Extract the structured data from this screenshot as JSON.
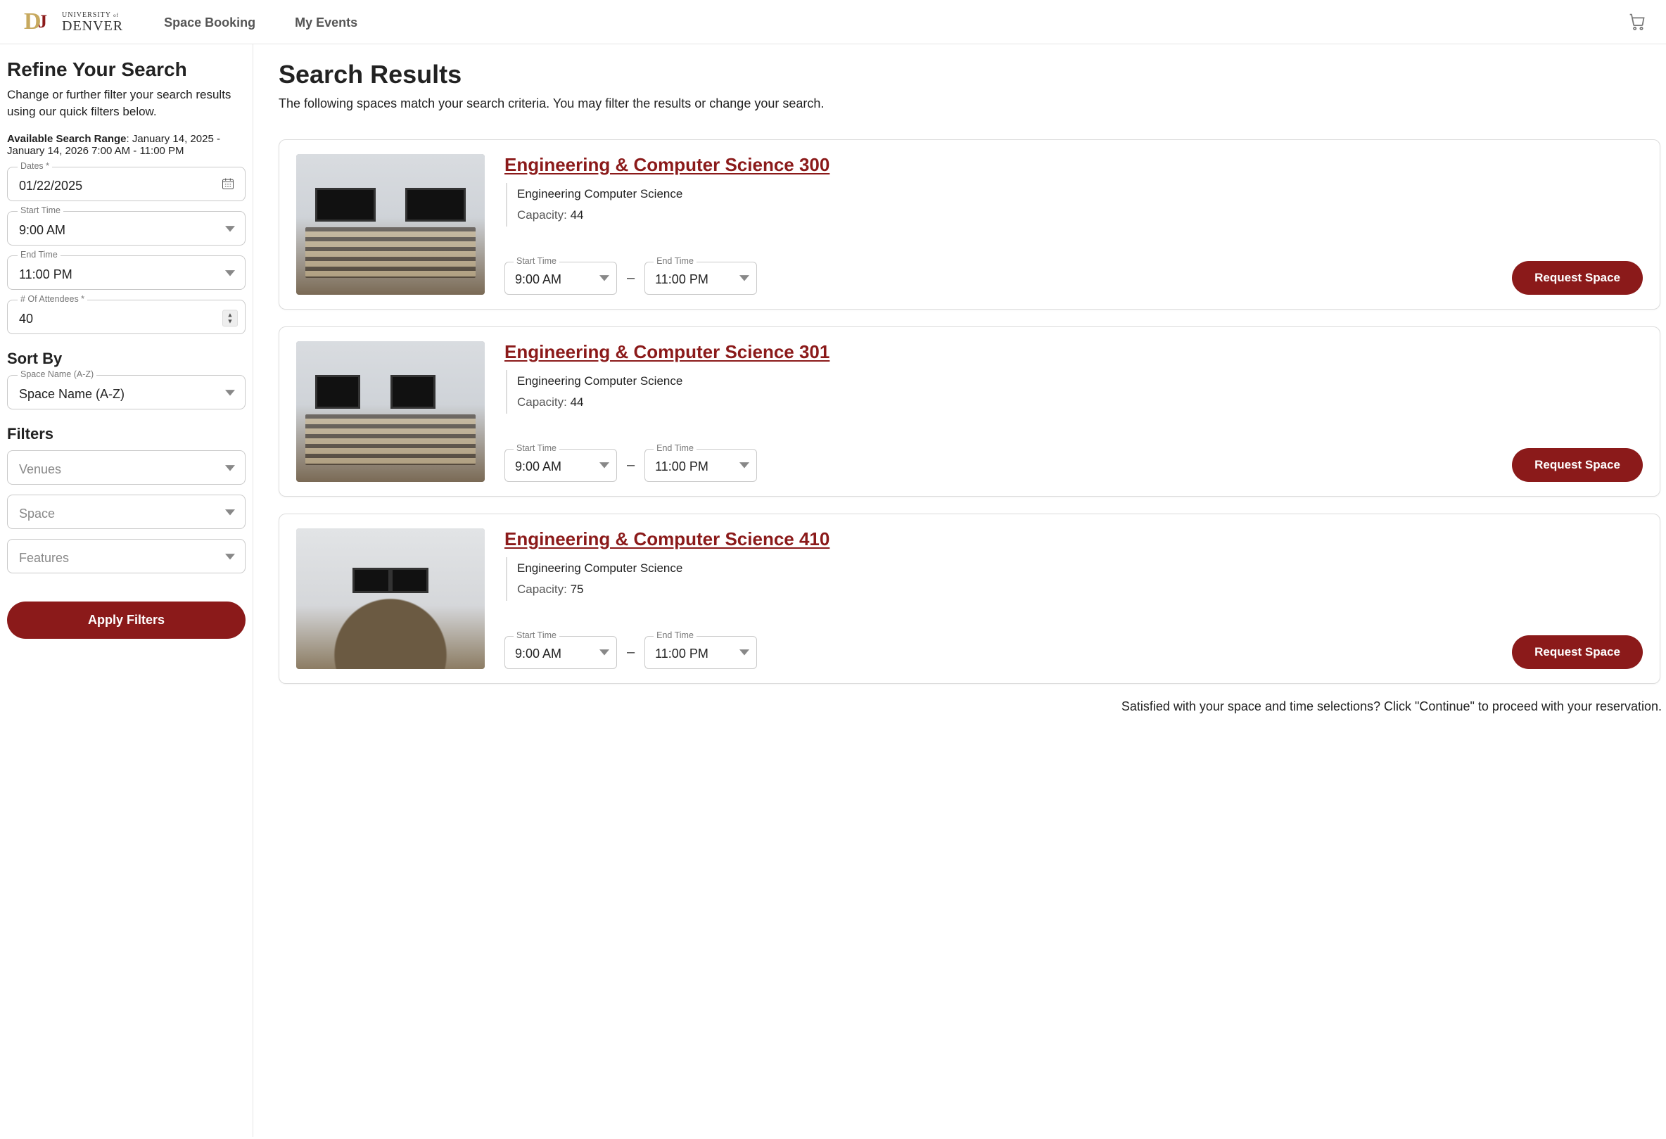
{
  "brand": {
    "university_of": "UNIVERSITY",
    "of_suffix": "of",
    "denver": "DENVER"
  },
  "nav": {
    "space_booking": "Space Booking",
    "my_events": "My Events"
  },
  "sidebar": {
    "title": "Refine Your Search",
    "subtitle": "Change or further filter your search results using our quick filters below.",
    "range_label": "Available Search Range",
    "range_value": ": January 14, 2025 - January 14, 2026 7:00 AM - 11:00 PM",
    "dates_label": "Dates *",
    "dates_value": "01/22/2025",
    "start_label": "Start Time",
    "start_value": "9:00 AM",
    "end_label": "End Time",
    "end_value": "11:00 PM",
    "attendees_label": "# Of Attendees *",
    "attendees_value": "40",
    "sort_heading": "Sort By",
    "sort_label": "Space Name (A-Z)",
    "sort_value": "Space Name (A-Z)",
    "filters_heading": "Filters",
    "venues_placeholder": "Venues",
    "space_placeholder": "Space",
    "features_placeholder": "Features",
    "apply_label": "Apply Filters"
  },
  "main": {
    "title": "Search Results",
    "subtitle": "The following spaces match your search criteria. You may filter the results or change your search.",
    "start_label": "Start Time",
    "end_label": "End Time",
    "capacity_label": "Capacity: ",
    "request_label": "Request Space",
    "footnote": "Satisfied with your space and time selections? Click \"Continue\" to proceed with your reservation."
  },
  "results": [
    {
      "title": "Engineering & Computer Science 300",
      "building": "Engineering Computer Science",
      "capacity": "44",
      "start": "9:00 AM",
      "end": "11:00 PM",
      "thumb_variant": ""
    },
    {
      "title": "Engineering & Computer Science 301",
      "building": "Engineering Computer Science",
      "capacity": "44",
      "start": "9:00 AM",
      "end": "11:00 PM",
      "thumb_variant": "alt"
    },
    {
      "title": "Engineering & Computer Science 410",
      "building": "Engineering Computer Science",
      "capacity": "75",
      "start": "9:00 AM",
      "end": "11:00 PM",
      "thumb_variant": "round"
    }
  ]
}
